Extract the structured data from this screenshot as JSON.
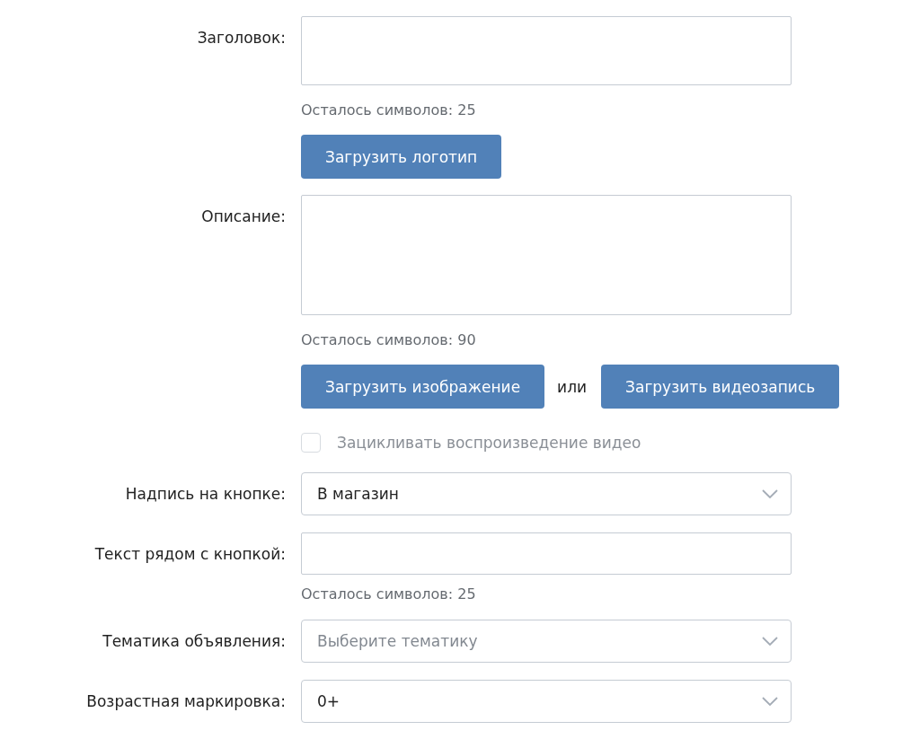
{
  "form": [
    {
      "kind": "textbox",
      "label": "Заголовок:",
      "counter": "Осталось символов: 25"
    },
    {
      "kind": "upload",
      "buttons": [
        "Загрузить логотип"
      ]
    },
    {
      "kind": "textarea",
      "label": "Описание:",
      "counter": "Осталось символов: 90"
    },
    {
      "kind": "upload",
      "buttons": [
        "Загрузить изображение",
        "Загрузить видеозапись"
      ],
      "separator": "или"
    },
    {
      "kind": "checkbox",
      "text": "Зацикливать воспроизведение видео",
      "checked": false,
      "disabled": true
    },
    {
      "kind": "select",
      "label": "Надпись на кнопке:",
      "value": "В магазин"
    },
    {
      "kind": "input",
      "label": "Текст рядом с кнопкой:",
      "counter": "Осталось символов: 25"
    },
    {
      "kind": "select",
      "label": "Тематика объявления:",
      "placeholder": "Выберите тематику"
    },
    {
      "kind": "select",
      "label": "Возрастная маркировка:",
      "value": "0+"
    }
  ]
}
